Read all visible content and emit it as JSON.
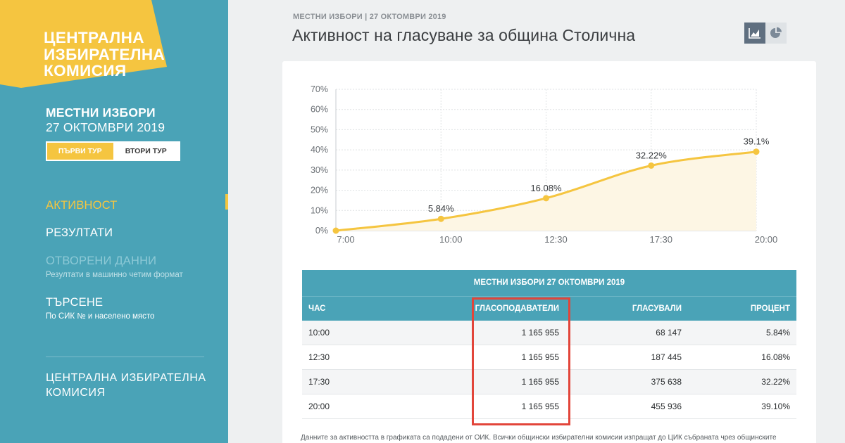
{
  "sidebar": {
    "logo_lines": [
      "ЦЕНТРАЛНА",
      "ИЗБИРАТЕЛНА",
      "КОМИСИЯ"
    ],
    "election_title": "МЕСТНИ ИЗБОРИ",
    "election_date": "27 ОКТОМВРИ 2019",
    "rounds": [
      "ПЪРВИ ТУР",
      "ВТОРИ ТУР"
    ],
    "nav": {
      "activity": "АКТИВНОСТ",
      "results": "РЕЗУЛТАТИ",
      "open_data": "ОТВОРЕНИ ДАННИ",
      "open_data_sub": "Резултати в машинно четим формат",
      "search": "ТЪРСЕНЕ",
      "search_sub": "По СИК № и населено място"
    },
    "footer_org_lines": [
      "ЦЕНТРАЛНА ИЗБИРАТЕЛНА",
      "КОМИСИЯ"
    ],
    "colors": {
      "sidebar_bg": "#4aa3b7",
      "accent_yellow": "#f5c540"
    }
  },
  "header": {
    "breadcrumb": "МЕСТНИ ИЗБОРИ | 27 ОКТОМВРИ 2019",
    "title": "Активност на гласуване за община Столична",
    "view_icons": [
      "line-chart-icon",
      "pie-chart-icon"
    ]
  },
  "chart_data": {
    "type": "area",
    "x": [
      "7:00",
      "10:00",
      "12:30",
      "17:30",
      "20:00"
    ],
    "values": [
      0,
      5.84,
      16.08,
      32.22,
      39.1
    ],
    "point_labels": [
      "",
      "5.84%",
      "16.08%",
      "32.22%",
      "39.1%"
    ],
    "y_ticks": [
      "0%",
      "10%",
      "20%",
      "30%",
      "40%",
      "50%",
      "60%",
      "70%"
    ],
    "ylim": [
      0,
      70
    ],
    "grid": true,
    "line_color": "#f5c540",
    "fill_color": "#fdf6e4"
  },
  "table": {
    "caption": "МЕСТНИ ИЗБОРИ 27 ОКТОМВРИ 2019",
    "headers": [
      "ЧАС",
      "ГЛАСОПОДАВАТЕЛИ",
      "ГЛАСУВАЛИ",
      "ПРОЦЕНТ"
    ],
    "rows": [
      [
        "10:00",
        "1 165 955",
        "68 147",
        "5.84%"
      ],
      [
        "12:30",
        "1 165 955",
        "187 445",
        "16.08%"
      ],
      [
        "17:30",
        "1 165 955",
        "375 638",
        "32.22%"
      ],
      [
        "20:00",
        "1 165 955",
        "455 936",
        "39.10%"
      ]
    ],
    "highlight_color": "#e2453a"
  },
  "note": "Данните за активността в графиката са подадени от ОИК. Всички общински избирателни комисии изпращат до ЦИК събраната чрез общинските"
}
